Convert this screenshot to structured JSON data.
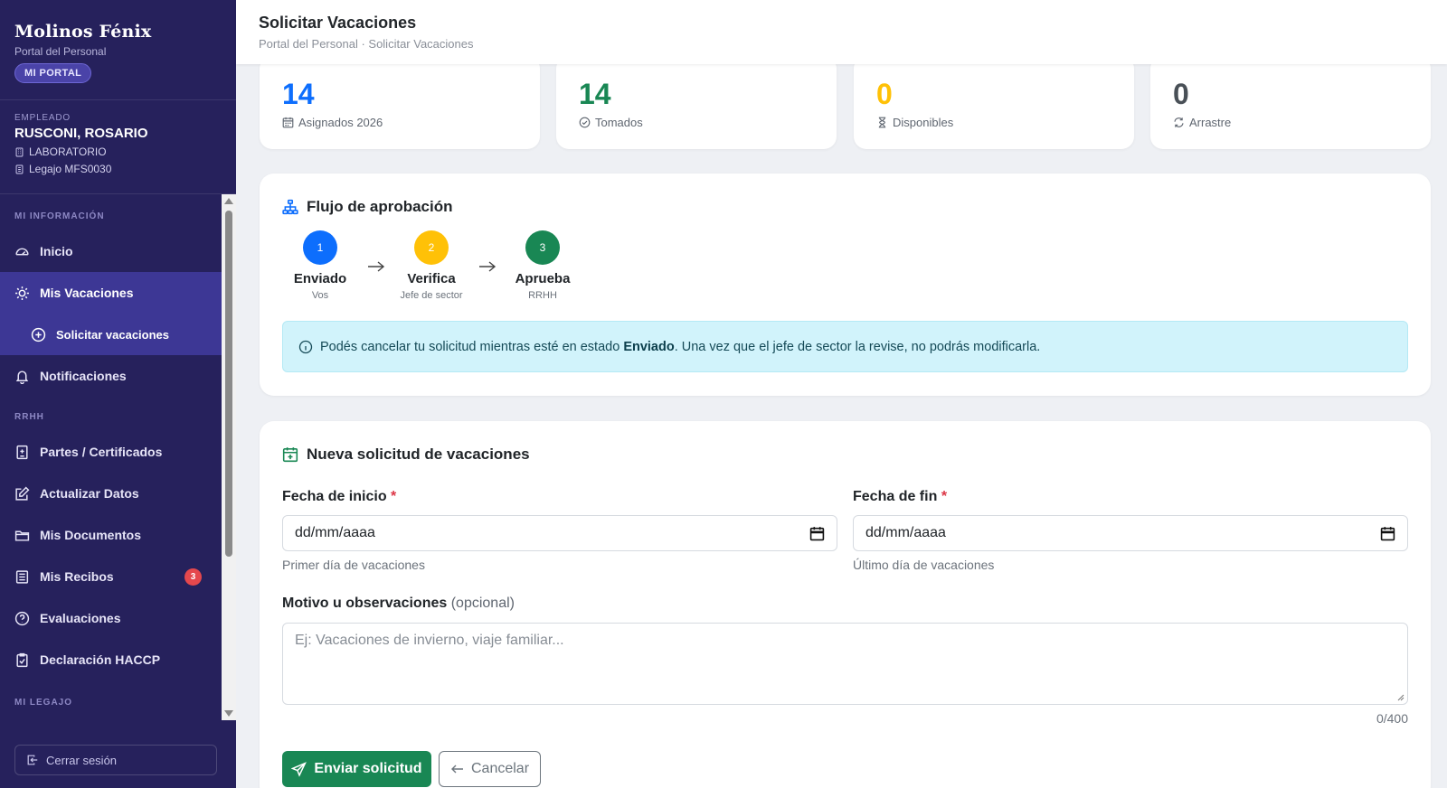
{
  "brand": {
    "title": "Molinos Fénix",
    "subtitle": "Portal del Personal",
    "badge": "MI PORTAL"
  },
  "employee": {
    "label": "EMPLEADO",
    "name": "RUSCONI, ROSARIO",
    "sector": "LABORATORIO",
    "legajo": "Legajo MFS0030"
  },
  "nav": {
    "section_info": "MI INFORMACIÓN",
    "inicio": "Inicio",
    "vacaciones": "Mis Vacaciones",
    "solicitar": "Solicitar vacaciones",
    "notificaciones": "Notificaciones",
    "section_rrhh": "RRHH",
    "partes": "Partes / Certificados",
    "actualizar": "Actualizar Datos",
    "documentos": "Mis Documentos",
    "recibos": "Mis Recibos",
    "recibos_badge": "3",
    "evaluaciones": "Evaluaciones",
    "haccp": "Declaración HACCP",
    "section_legajo": "MI LEGAJO"
  },
  "logout": "Cerrar sesión",
  "header": {
    "title": "Solicitar Vacaciones",
    "breadcrumb": "Portal del Personal · Solicitar Vacaciones"
  },
  "stats": [
    {
      "value": "14",
      "label": "Asignados 2026",
      "color": "#0d6efd",
      "icon": "calendar-icon"
    },
    {
      "value": "14",
      "label": "Tomados",
      "color": "#198754",
      "icon": "check-circle-icon"
    },
    {
      "value": "0",
      "label": "Disponibles",
      "color": "#ffc107",
      "icon": "hourglass-icon"
    },
    {
      "value": "0",
      "label": "Arrastre",
      "color": "#495057",
      "icon": "refresh-icon"
    }
  ],
  "flow": {
    "title": "Flujo de aprobación",
    "steps": [
      {
        "number": "1",
        "name": "Enviado",
        "who": "Vos",
        "color": "#0d6efd"
      },
      {
        "number": "2",
        "name": "Verifica",
        "who": "Jefe de sector",
        "color": "#ffc107"
      },
      {
        "number": "3",
        "name": "Aprueba",
        "who": "RRHH",
        "color": "#198754"
      }
    ],
    "alert_before": "Podés cancelar tu solicitud mientras esté en estado ",
    "alert_bold": "Enviado",
    "alert_after": ". Una vez que el jefe de sector la revise, no podrás modificarla."
  },
  "form": {
    "title": "Nueva solicitud de vacaciones",
    "start_label": "Fecha de inicio",
    "start_value": "dd/mm/aaaa",
    "start_help": "Primer día de vacaciones",
    "end_label": "Fecha de fin",
    "end_value": "dd/mm/aaaa",
    "end_help": "Último día de vacaciones",
    "required_mark": "*",
    "motivo_label": "Motivo u observaciones",
    "motivo_optional": "(opcional)",
    "motivo_placeholder": "Ej: Vacaciones de invierno, viaje familiar...",
    "counter": "0/400",
    "submit": "Enviar solicitud",
    "cancel": "Cancelar"
  }
}
